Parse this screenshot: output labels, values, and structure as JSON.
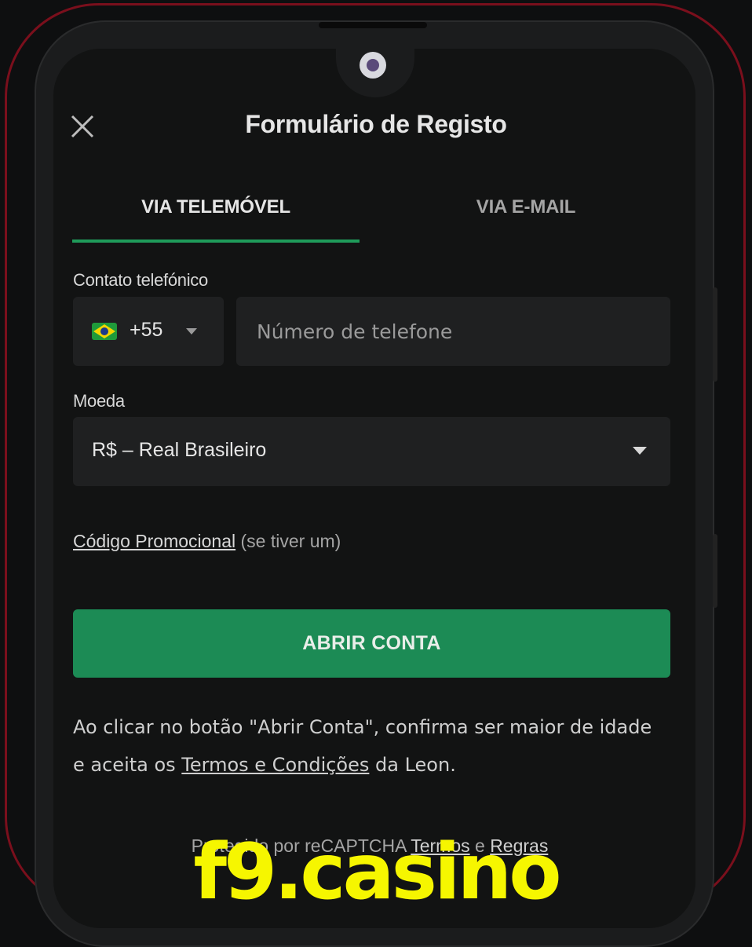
{
  "form": {
    "title": "Formulário de Registo",
    "tabs": [
      {
        "label": "VIA TELEMÓVEL",
        "active": true
      },
      {
        "label": "VIA E-MAIL",
        "active": false
      }
    ],
    "phone_label": "Contato telefónico",
    "country_code": "+55",
    "phone_placeholder": "Número de telefone",
    "currency_label": "Moeda",
    "currency_value": "R$ – Real Brasileiro",
    "promo_link": "Código Promocional",
    "promo_hint": "(se tiver um)",
    "submit_label": "ABRIR CONTA",
    "disclaimer_before": "Ao clicar no botão \"Abrir Conta\", confirma ser maior de idade e aceita os ",
    "disclaimer_link": "Termos e Condições",
    "disclaimer_after": " da Leon.",
    "recaptcha_text": "Protegido por reCAPTCHA",
    "recaptcha_terms": "Termos",
    "recaptcha_and": "e",
    "recaptcha_rules": "Regras"
  },
  "watermark": "f9.casino",
  "icons": {
    "close": "close-icon",
    "flag": "brazil-flag-icon",
    "caret": "caret-down-icon"
  },
  "colors": {
    "accent": "#1f9b5a",
    "button": "#1c8b55",
    "frame": "#7a0f1c",
    "watermark": "#f6f600"
  }
}
